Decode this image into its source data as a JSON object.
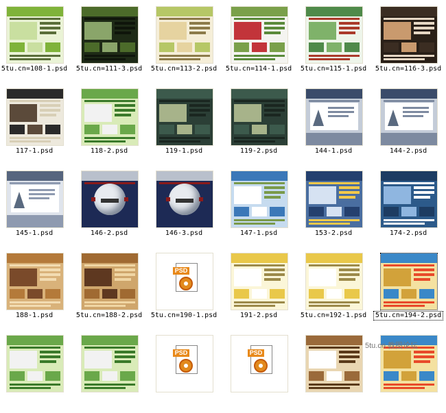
{
  "items": [
    {
      "label": "5tu.cn=108-1.psd",
      "art": "green"
    },
    {
      "label": "5tu.cn=111-3.psd",
      "art": "forest"
    },
    {
      "label": "5tu.cn=113-2.psd",
      "art": "beige"
    },
    {
      "label": "5tu.cn=114-1.psd",
      "art": "flower"
    },
    {
      "label": "5tu.cn=115-1.psd",
      "art": "garden"
    },
    {
      "label": "5tu.cn=116-3.psd",
      "art": "faces"
    },
    {
      "label": "117-1.psd",
      "art": "dark"
    },
    {
      "label": "118-2.psd",
      "art": "greenweb"
    },
    {
      "label": "119-1.psd",
      "art": "teal"
    },
    {
      "label": "119-2.psd",
      "art": "teal"
    },
    {
      "label": "144-1.psd",
      "art": "sail"
    },
    {
      "label": "144-2.psd",
      "art": "sail"
    },
    {
      "label": "145-1.psd",
      "art": "sail2"
    },
    {
      "label": "146-2.psd",
      "art": "orb"
    },
    {
      "label": "146-3.psd",
      "art": "orb"
    },
    {
      "label": "147-1.psd",
      "art": "blueweb"
    },
    {
      "label": "153-2.psd",
      "art": "navyweb"
    },
    {
      "label": "174-2.psd",
      "art": "bluecloud"
    },
    {
      "label": "188-1.psd",
      "art": "tan"
    },
    {
      "label": "5tu.cn=188-2.psd",
      "art": "tan2"
    },
    {
      "label": "5tu.cn=190-1.psd",
      "art": "psd"
    },
    {
      "label": "191-2.psd",
      "art": "yellow"
    },
    {
      "label": "5tu.cn=192-1.psd",
      "art": "yellow"
    },
    {
      "label": "5tu.cn=194-2.psd",
      "art": "field",
      "selected": true
    },
    {
      "label": "",
      "art": "greenweb"
    },
    {
      "label": "",
      "art": "greenweb"
    },
    {
      "label": "",
      "art": "psd"
    },
    {
      "label": "",
      "art": "psd"
    },
    {
      "label": "",
      "art": "coffee"
    },
    {
      "label": "",
      "art": "field"
    }
  ],
  "psd_icon_text": "PSD",
  "watermark": "5tu.cn 教图论坛"
}
